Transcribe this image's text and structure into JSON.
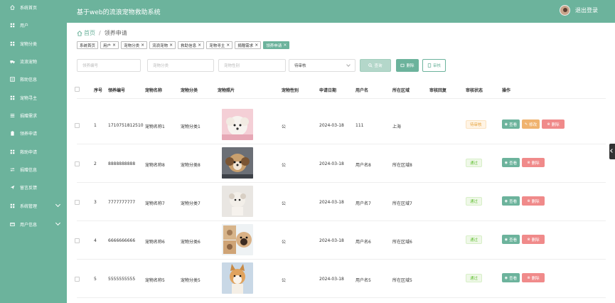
{
  "header": {
    "home_label": "系统首页",
    "system_title": "基于web的流浪宠物救助系统",
    "logout_label": "退出登录"
  },
  "sidebar": {
    "items": [
      {
        "label": "用户",
        "icon": "grid-icon"
      },
      {
        "label": "宠物分类",
        "icon": "grid-icon"
      },
      {
        "label": "流浪宠物",
        "icon": "truck-icon"
      },
      {
        "label": "救助信息",
        "icon": "list-icon"
      },
      {
        "label": "宠物寻主",
        "icon": "grid-icon"
      },
      {
        "label": "捐赠需求",
        "icon": "menu-icon"
      },
      {
        "label": "领养申请",
        "icon": "clipboard-icon"
      },
      {
        "label": "救助申请",
        "icon": "grid-icon"
      },
      {
        "label": "捐赠信息",
        "icon": "sliders-icon"
      },
      {
        "label": "留言反馈",
        "icon": "send-icon"
      },
      {
        "label": "系统管理",
        "icon": "grid-icon"
      },
      {
        "label": "用户信息",
        "icon": "card-icon"
      }
    ]
  },
  "breadcrumb": {
    "home": "首页",
    "separator": "/",
    "current": "领养申请"
  },
  "tags": [
    {
      "label": "系统首页",
      "closable": false,
      "active": false
    },
    {
      "label": "用户",
      "closable": true,
      "active": false
    },
    {
      "label": "宠物分类",
      "closable": true,
      "active": false
    },
    {
      "label": "流浪宠物",
      "closable": true,
      "active": false
    },
    {
      "label": "救助信息",
      "closable": true,
      "active": false
    },
    {
      "label": "宠物寻主",
      "closable": true,
      "active": false
    },
    {
      "label": "捐赠需求",
      "closable": true,
      "active": false
    },
    {
      "label": "领养申请",
      "closable": true,
      "active": true
    }
  ],
  "search": {
    "adopt_no_placeholder": "领养编号",
    "category_placeholder": "宠物分类",
    "gender_placeholder": "宠物性别",
    "status_value": "待审核",
    "search_label": "查询",
    "delete_label": "删除",
    "audit_label": "审核"
  },
  "table": {
    "headers": [
      "序号",
      "领养编号",
      "宠物名称",
      "宠物分类",
      "宠物照片",
      "宠物性别",
      "申请日期",
      "用户名",
      "所在区域",
      "审核回复",
      "审核状态",
      "操作"
    ],
    "view_label": "查看",
    "edit_label": "修改",
    "delete_label": "删除",
    "rows": [
      {
        "index": "1",
        "adopt_no": "1710751812510",
        "pet_name": "宠物名称1",
        "category": "宠物分类1",
        "gender": "公",
        "date": "2024-03-18",
        "username": "111",
        "area": "上海",
        "reply": "",
        "status": "待审核",
        "status_kind": "pending",
        "editable": true
      },
      {
        "index": "2",
        "adopt_no": "8888888888",
        "pet_name": "宠物名称8",
        "category": "宠物分类8",
        "gender": "公",
        "date": "2024-03-18",
        "username": "用户名8",
        "area": "所在区域8",
        "reply": "",
        "status": "通过",
        "status_kind": "passed",
        "editable": false
      },
      {
        "index": "3",
        "adopt_no": "7777777777",
        "pet_name": "宠物名称7",
        "category": "宠物分类7",
        "gender": "公",
        "date": "2024-03-18",
        "username": "用户名7",
        "area": "所在区域7",
        "reply": "",
        "status": "通过",
        "status_kind": "passed",
        "editable": false
      },
      {
        "index": "4",
        "adopt_no": "6666666666",
        "pet_name": "宠物名称6",
        "category": "宠物分类6",
        "gender": "公",
        "date": "2024-03-18",
        "username": "用户名6",
        "area": "所在区域6",
        "reply": "",
        "status": "通过",
        "status_kind": "passed",
        "editable": false
      },
      {
        "index": "5",
        "adopt_no": "5555555555",
        "pet_name": "宠物名称5",
        "category": "宠物分类5",
        "gender": "公",
        "date": "2024-03-18",
        "username": "用户名5",
        "area": "所在区域5",
        "reply": "",
        "status": "通过",
        "status_kind": "passed",
        "editable": false
      }
    ]
  },
  "colors": {
    "brand": "#6cb39c",
    "pending": "#e6a23c",
    "passed": "#67c23a",
    "danger": "#f08a8a",
    "warning": "#f0b36f"
  }
}
